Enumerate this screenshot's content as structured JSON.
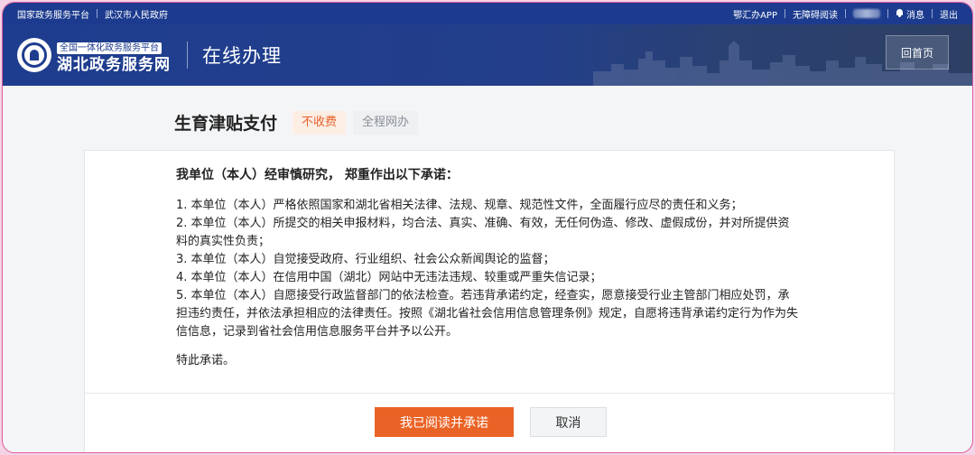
{
  "topbar": {
    "left": [
      "国家政务服务平台",
      "武汉市人民政府"
    ],
    "app_link": "鄂汇办APP",
    "accessibility_link": "无障碍阅读",
    "messages": "消息",
    "logout": "退出"
  },
  "header": {
    "tag": "全国一体化政务服务平台",
    "brand": "湖北政务服务网",
    "section_title": "在线办理",
    "home_button": "回首页"
  },
  "service": {
    "title": "生育津贴支付",
    "badges": [
      "不收费",
      "全程网办"
    ]
  },
  "pledge": {
    "heading": "我单位（本人）经审慎研究， 郑重作出以下承诺：",
    "items": [
      "1. 本单位（本人）严格依照国家和湖北省相关法律、法规、规章、规范性文件，全面履行应尽的责任和义务；",
      "2. 本单位（本人）所提交的相关申报材料，均合法、真实、准确、有效，无任何伪造、修改、虚假成份，并对所提供资料的真实性负责；",
      "3. 本单位（本人）自觉接受政府、行业组织、社会公众新闻舆论的监督；",
      "4. 本单位（本人）在信用中国（湖北）网站中无违法违规、较重或严重失信记录；",
      "5. 本单位（本人）自愿接受行政监督部门的依法检查。若违背承诺约定，经查实，愿意接受行业主管部门相应处罚，承担违约责任，并依法承担相应的法律责任。按照《湖北省社会信用信息管理条例》规定，自愿将违背承诺约定行为作为失信信息，记录到省社会信用信息服务平台并予以公开。"
    ],
    "closing": "特此承诺。"
  },
  "actions": {
    "agree": "我已阅读并承诺",
    "cancel": "取消"
  }
}
